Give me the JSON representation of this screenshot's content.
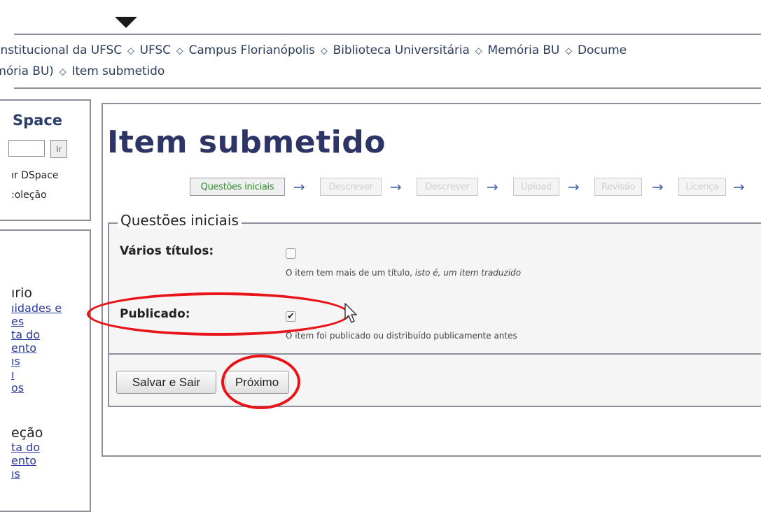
{
  "breadcrumb": {
    "line1": [
      "o Institucional da UFSC",
      "UFSC",
      "Campus Florianópolis",
      "Biblioteca Universitária",
      "Memória BU",
      "Docume"
    ],
    "line2": [
      "emória BU)",
      "Item submetido"
    ],
    "separator_icon": "diamond-arrow-icon"
  },
  "sidebar": {
    "title": "Space",
    "go_button": "Ir",
    "link1": "ır DSpace",
    "link2": ":oleção",
    "section1_heading": "ırio",
    "section1_links": [
      "ıidades e",
      "es",
      "ta do",
      "ento",
      "ıs",
      "ı",
      "os"
    ],
    "section2_heading": "eção",
    "section2_links": [
      "ta do",
      "ento",
      "ıs"
    ]
  },
  "main": {
    "title": "Item submetido",
    "steps": [
      {
        "label": "Questões iniciais",
        "active": true
      },
      {
        "label": "Descrever",
        "active": false
      },
      {
        "label": "Descrever",
        "active": false
      },
      {
        "label": "Upload",
        "active": false
      },
      {
        "label": "Revisão",
        "active": false
      },
      {
        "label": "Licença",
        "active": false
      }
    ],
    "step_arrow": "→",
    "fieldset_legend": "Questões iniciais",
    "fields": [
      {
        "label": "Vários títulos:",
        "checked": false,
        "help_prefix": "O item tem mais de um título, ",
        "help_italic": "isto é, um item traduzido"
      },
      {
        "label": "Publicado:",
        "checked": true,
        "check_mark": "✔",
        "help": "O item foi publicado ou distribuído publicamente antes"
      }
    ],
    "buttons": {
      "save_exit": "Salvar e Sair",
      "next": "Próximo"
    }
  },
  "annotations": {
    "color": "#e8141a"
  }
}
